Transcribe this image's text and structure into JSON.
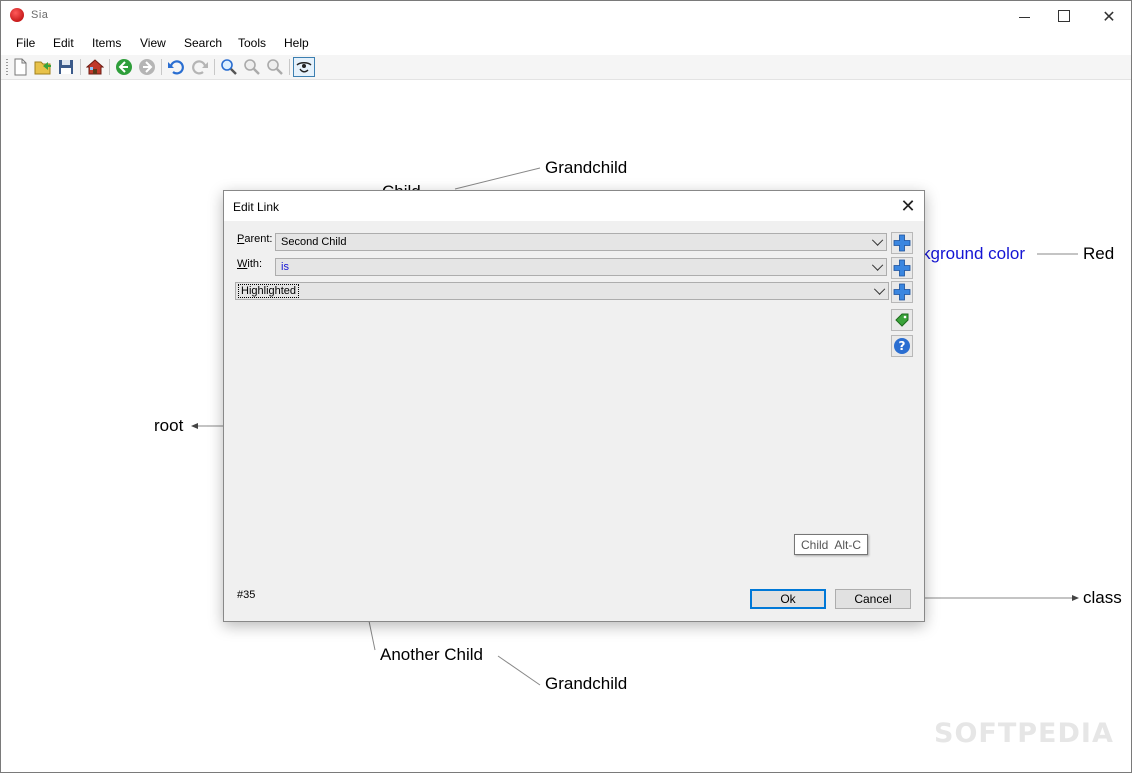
{
  "app": {
    "title": "Sia"
  },
  "window_controls": {
    "minimize": "–",
    "close": "✕"
  },
  "menu": [
    "File",
    "Edit",
    "Items",
    "View",
    "Search",
    "Tools",
    "Help"
  ],
  "toolbar": {
    "icons": [
      "new-icon",
      "open-icon",
      "save-icon",
      "home-icon",
      "back-icon",
      "forward-icon",
      "undo-icon",
      "redo-icon",
      "search-icon",
      "zoom-in-icon",
      "zoom-out-icon",
      "eye-icon"
    ]
  },
  "diagram": {
    "nodes": {
      "grandchild_top": "Grandchild",
      "child_partial": "Child",
      "background_color": "kground color",
      "red": "Red",
      "root": "root",
      "class": "class",
      "another_child": "Another Child",
      "grandchild_bottom": "Grandchild"
    }
  },
  "dialog": {
    "title": "Edit Link",
    "close": "✕",
    "parent": {
      "label_underline": "P",
      "label_rest": "arent:",
      "value": "Second Child"
    },
    "with": {
      "label_underline": "W",
      "label_rest": "ith:",
      "value": "is"
    },
    "target": {
      "value": "Highlighted"
    },
    "tooltip": "Child  Alt-C",
    "help": "?",
    "record_number": "#35",
    "ok_label": "Ok",
    "cancel_label": "Cancel"
  },
  "colors": {
    "link_blue": "#1414d4",
    "accent": "#0078d7",
    "plus_blue": "#2a74d4"
  },
  "watermark": "SOFTPEDIA"
}
